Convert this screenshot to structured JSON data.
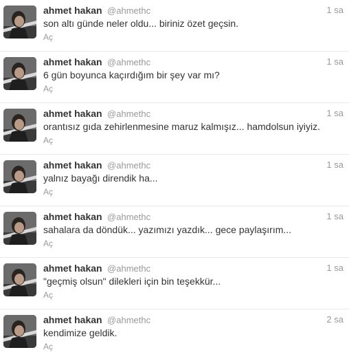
{
  "timeline": {
    "tweets": [
      {
        "fullname": "ahmet hakan",
        "username": "@ahmethc",
        "time": "1 sa",
        "text": "son altı günde neler oldu... biriniz özet geçsin.",
        "expand_label": "Aç"
      },
      {
        "fullname": "ahmet hakan",
        "username": "@ahmethc",
        "time": "1 sa",
        "text": "6 gün boyunca kaçırdığım bir şey var mı?",
        "expand_label": "Aç"
      },
      {
        "fullname": "ahmet hakan",
        "username": "@ahmethc",
        "time": "1 sa",
        "text": "orantısız gıda zehirlenmesine maruz kalmışız... hamdolsun iyiyiz.",
        "expand_label": "Aç"
      },
      {
        "fullname": "ahmet hakan",
        "username": "@ahmethc",
        "time": "1 sa",
        "text": "yalnız bayağı direndik ha...",
        "expand_label": "Aç"
      },
      {
        "fullname": "ahmet hakan",
        "username": "@ahmethc",
        "time": "1 sa",
        "text": "sahalara da döndük... yazımızı yazdık... gece paylaşırım...",
        "expand_label": "Aç"
      },
      {
        "fullname": "ahmet hakan",
        "username": "@ahmethc",
        "time": "1 sa",
        "text": "\"geçmiş olsun\" dilekleri için bin teşekkür...",
        "expand_label": "Aç"
      },
      {
        "fullname": "ahmet hakan",
        "username": "@ahmethc",
        "time": "2 sa",
        "text": "kendimize geldik.",
        "expand_label": "Aç"
      }
    ]
  },
  "colors": {
    "name": "#333333",
    "meta": "#999999",
    "divider": "#e8e8e8"
  },
  "icons": {
    "avatar": "profile-photo"
  }
}
